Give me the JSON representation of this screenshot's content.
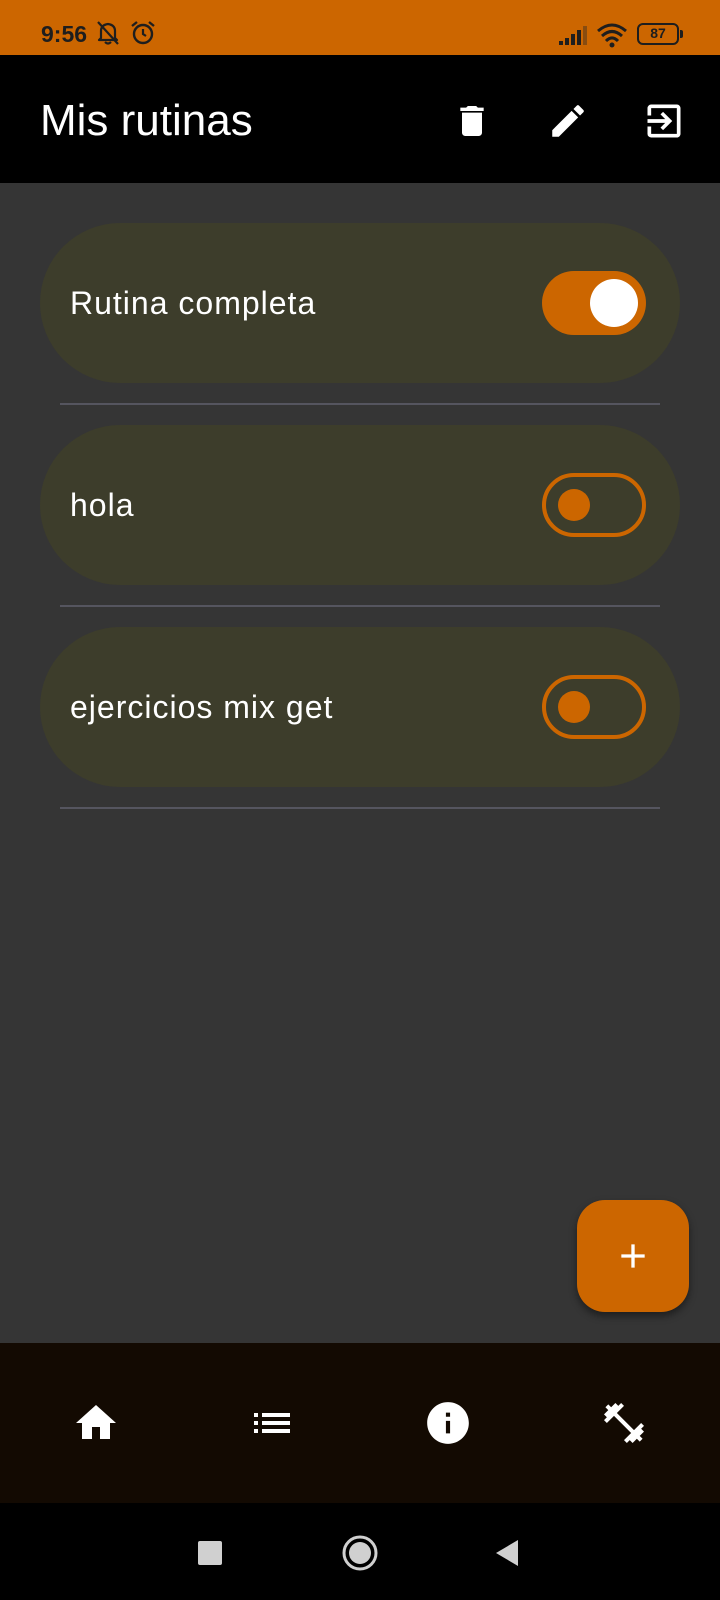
{
  "status_bar": {
    "time": "9:56",
    "icons": [
      "notifications-off-icon",
      "alarm-icon",
      "signal-icon",
      "wifi-icon"
    ],
    "battery": "87",
    "color": "#cc6600"
  },
  "app_bar": {
    "title": "Mis rutinas",
    "actions": [
      "delete-icon",
      "edit-icon",
      "exit-icon"
    ]
  },
  "routines": [
    {
      "name": "Rutina completa",
      "enabled": true
    },
    {
      "name": "hola",
      "enabled": false
    },
    {
      "name": "ejercicios mix get",
      "enabled": false
    }
  ],
  "fab": {
    "icon": "add-icon"
  },
  "bottom_nav": {
    "items": [
      "home-icon",
      "list-icon",
      "info-icon",
      "fitness-icon"
    ]
  },
  "system_nav": {
    "buttons": [
      "recent-apps-icon",
      "home-circle-icon",
      "back-icon"
    ]
  },
  "colors": {
    "accent": "#cc6600",
    "background": "#353535",
    "card": "#3d3d2b",
    "app_bar": "#000000",
    "bottom_nav": "#130a02"
  }
}
